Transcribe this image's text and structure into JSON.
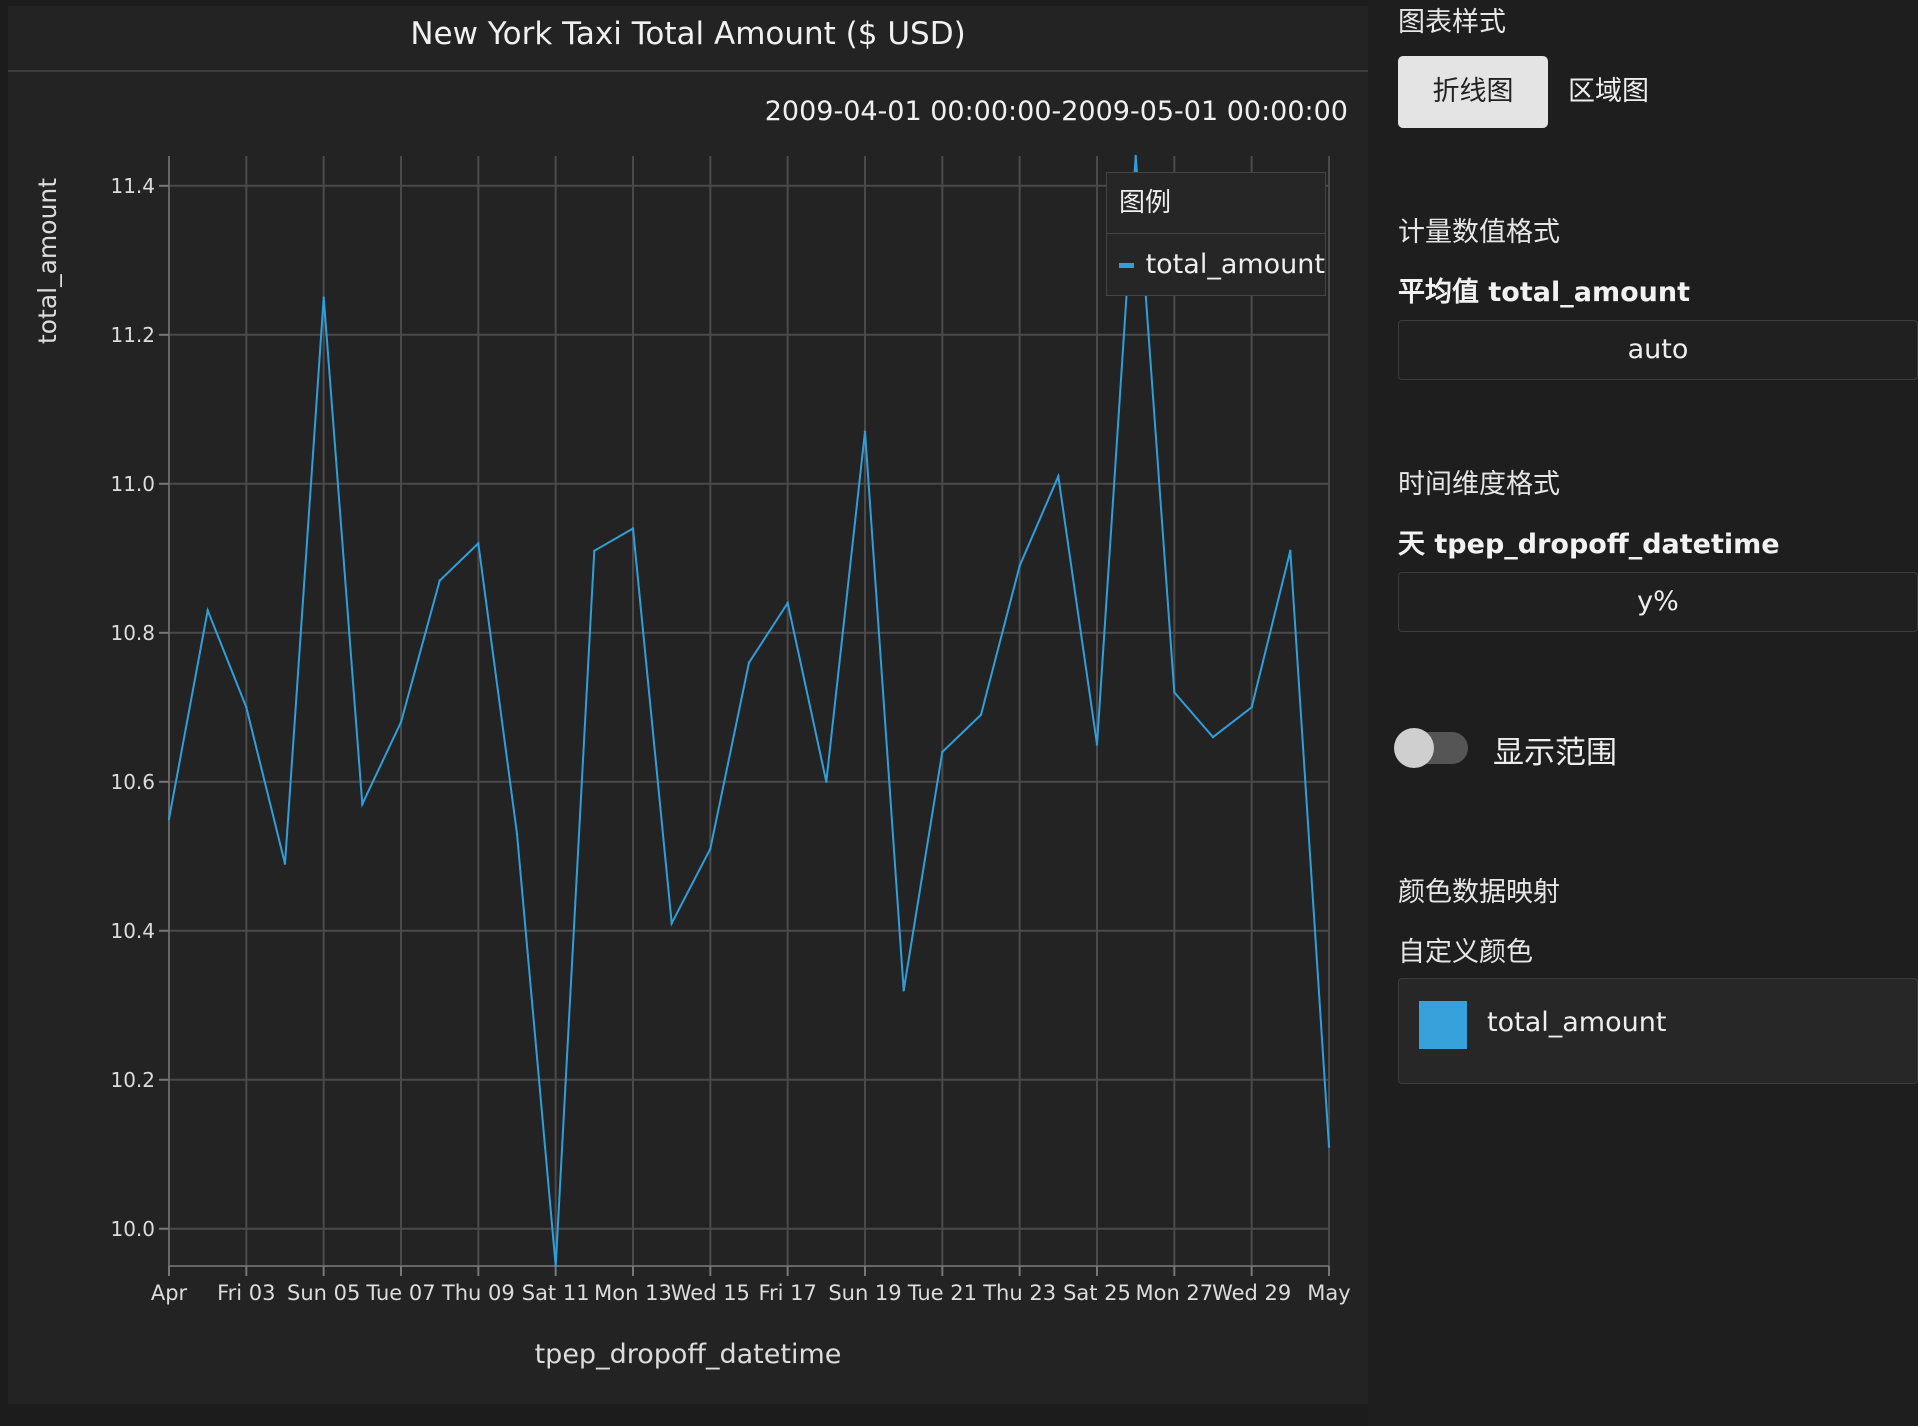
{
  "chart_data": {
    "type": "line",
    "title": "New York Taxi Total Amount ($ USD)",
    "subtitle": "2009-04-01 00:00:00-2009-05-01 00:00:00",
    "xlabel": "tpep_dropoff_datetime",
    "ylabel": "total_amount",
    "ylim": [
      9.95,
      11.44
    ],
    "xlim": [
      "2009-04-01",
      "2009-05-01"
    ],
    "yticks": [
      "10.0",
      "10.2",
      "10.4",
      "10.6",
      "10.8",
      "11.0",
      "11.2",
      "11.4"
    ],
    "xticks": [
      {
        "date": "2009-04-01",
        "label": "Apr"
      },
      {
        "date": "2009-04-03",
        "label": "Fri 03"
      },
      {
        "date": "2009-04-05",
        "label": "Sun 05"
      },
      {
        "date": "2009-04-07",
        "label": "Tue 07"
      },
      {
        "date": "2009-04-09",
        "label": "Thu 09"
      },
      {
        "date": "2009-04-11",
        "label": "Sat 11"
      },
      {
        "date": "2009-04-13",
        "label": "Mon 13"
      },
      {
        "date": "2009-04-15",
        "label": "Wed 15"
      },
      {
        "date": "2009-04-17",
        "label": "Fri 17"
      },
      {
        "date": "2009-04-19",
        "label": "Sun 19"
      },
      {
        "date": "2009-04-21",
        "label": "Tue 21"
      },
      {
        "date": "2009-04-23",
        "label": "Thu 23"
      },
      {
        "date": "2009-04-25",
        "label": "Sat 25"
      },
      {
        "date": "2009-04-27",
        "label": "Mon 27"
      },
      {
        "date": "2009-04-29",
        "label": "Wed 29"
      },
      {
        "date": "2009-05-01",
        "label": "May"
      }
    ],
    "grid": true,
    "legend": {
      "title": "图例",
      "placement": "top-right"
    },
    "series": [
      {
        "name": "total_amount",
        "color": "#2f9fdc",
        "x": [
          "2009-04-01",
          "2009-04-02",
          "2009-04-03",
          "2009-04-04",
          "2009-04-05",
          "2009-04-06",
          "2009-04-07",
          "2009-04-08",
          "2009-04-09",
          "2009-04-10",
          "2009-04-11",
          "2009-04-12",
          "2009-04-13",
          "2009-04-14",
          "2009-04-15",
          "2009-04-16",
          "2009-04-17",
          "2009-04-18",
          "2009-04-19",
          "2009-04-20",
          "2009-04-21",
          "2009-04-22",
          "2009-04-23",
          "2009-04-24",
          "2009-04-25",
          "2009-04-26",
          "2009-04-27",
          "2009-04-28",
          "2009-04-29",
          "2009-04-30",
          "2009-05-01"
        ],
        "values": [
          10.55,
          10.83,
          10.7,
          10.49,
          11.25,
          10.57,
          10.68,
          10.87,
          10.92,
          10.53,
          9.95,
          10.91,
          10.94,
          10.41,
          10.51,
          10.76,
          10.84,
          10.6,
          11.07,
          10.32,
          10.64,
          10.69,
          10.89,
          11.01,
          10.65,
          11.44,
          10.72,
          10.66,
          10.7,
          10.91,
          10.11
        ]
      }
    ]
  },
  "sidebar": {
    "chart_style_label": "图表样式",
    "line_button": "折线图",
    "area_button": "区域图",
    "metric_format_label": "计量数值格式",
    "metric_name": "平均值 total_amount",
    "metric_format_value": "auto",
    "time_format_label": "时间维度格式",
    "time_dim_name": "天 tpep_dropoff_datetime",
    "time_format_value": "y%",
    "show_range_label": "显示范围",
    "color_mapping_label": "颜色数据映射",
    "custom_color_label": "自定义颜色",
    "custom_color_series": "total_amount",
    "custom_color_value": "#37a1dc"
  }
}
